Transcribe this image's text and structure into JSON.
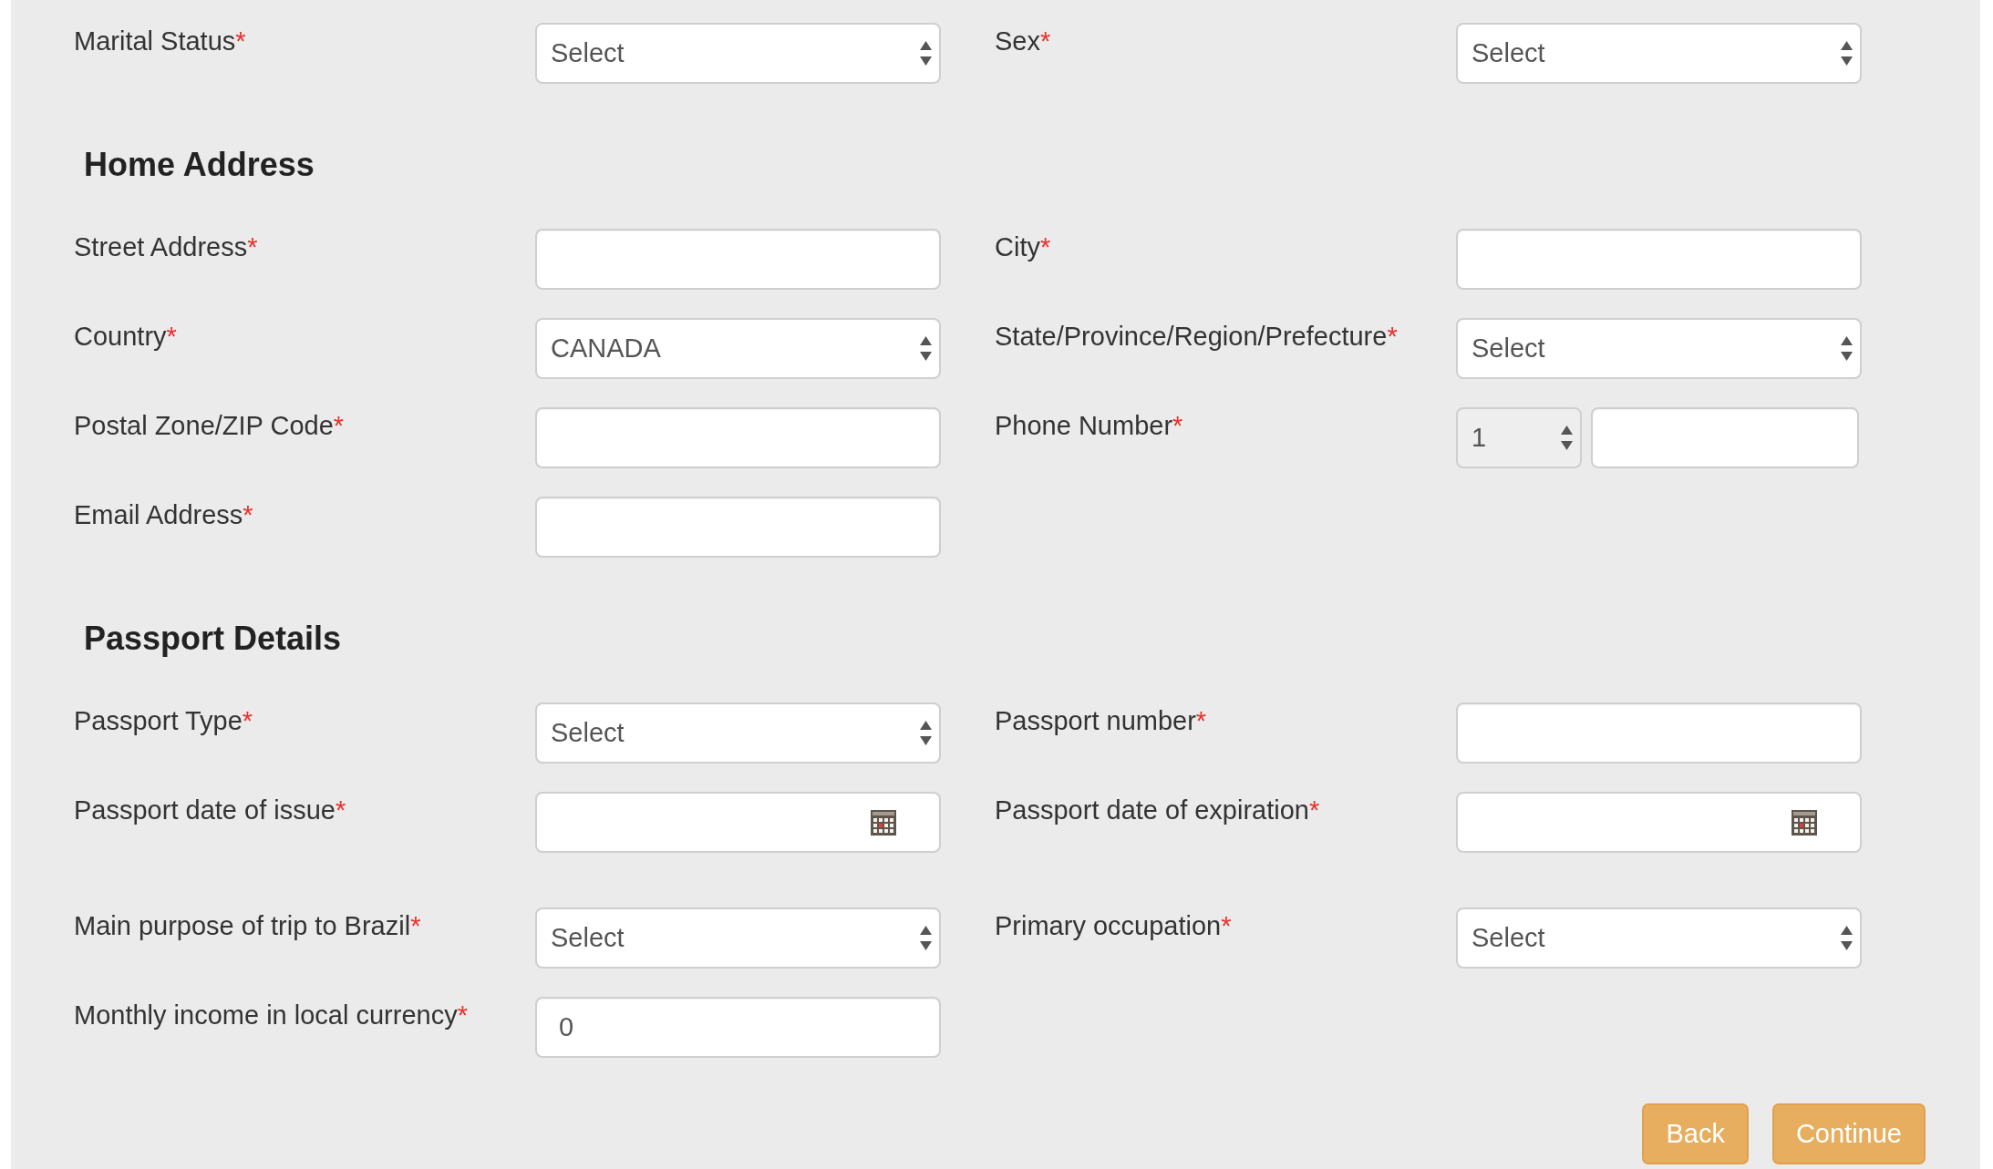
{
  "sections": [
    {
      "rows": [
        {
          "fields": [
            {
              "kind": "select",
              "label": "Marital Status",
              "required_mark": "*",
              "value": "Select"
            },
            {
              "kind": "select",
              "label": "Sex",
              "required_mark": "*",
              "value": "Select"
            }
          ]
        }
      ]
    },
    {
      "title": "Home Address",
      "rows": [
        {
          "fields": [
            {
              "kind": "text",
              "label": "Street Address",
              "required_mark": "*"
            },
            {
              "kind": "text",
              "label": "City",
              "required_mark": "*"
            }
          ]
        },
        {
          "fields": [
            {
              "kind": "select",
              "label": "Country",
              "required_mark": "*",
              "value": "CANADA"
            },
            {
              "kind": "select",
              "label": "State/Province/Region/Prefecture",
              "required_mark": "*",
              "value": "Select"
            }
          ]
        },
        {
          "fields": [
            {
              "kind": "text",
              "label": "Postal Zone/ZIP Code",
              "required_mark": "*"
            },
            {
              "kind": "phone",
              "label": "Phone Number",
              "required_mark": "*",
              "code": {
                "value": "1",
                "disabled": true
              }
            }
          ]
        },
        {
          "fields": [
            {
              "kind": "text",
              "label": "Email Address",
              "required_mark": "*"
            }
          ]
        }
      ]
    },
    {
      "title": "Passport Details",
      "rows": [
        {
          "fields": [
            {
              "kind": "select",
              "label": "Passport Type",
              "required_mark": "*",
              "value": "Select"
            },
            {
              "kind": "text",
              "label": "Passport number",
              "required_mark": "*"
            }
          ]
        },
        {
          "fields": [
            {
              "kind": "date",
              "label": "Passport date of issue",
              "required_mark": "*"
            },
            {
              "kind": "date",
              "label": "Passport date of expiration",
              "required_mark": "*"
            }
          ]
        },
        {
          "fields": [
            {
              "kind": "select",
              "label": "Main purpose of trip to Brazil",
              "required_mark": "*",
              "value": "Select"
            },
            {
              "kind": "select",
              "label": "Primary occupation",
              "required_mark": "*",
              "value": "Select"
            }
          ]
        },
        {
          "fields": [
            {
              "kind": "text",
              "label": "Monthly income in local currency",
              "required_mark": "*",
              "value": "0"
            }
          ]
        }
      ]
    }
  ],
  "buttons": [
    {
      "label": "Back"
    },
    {
      "label": "Continue"
    }
  ]
}
